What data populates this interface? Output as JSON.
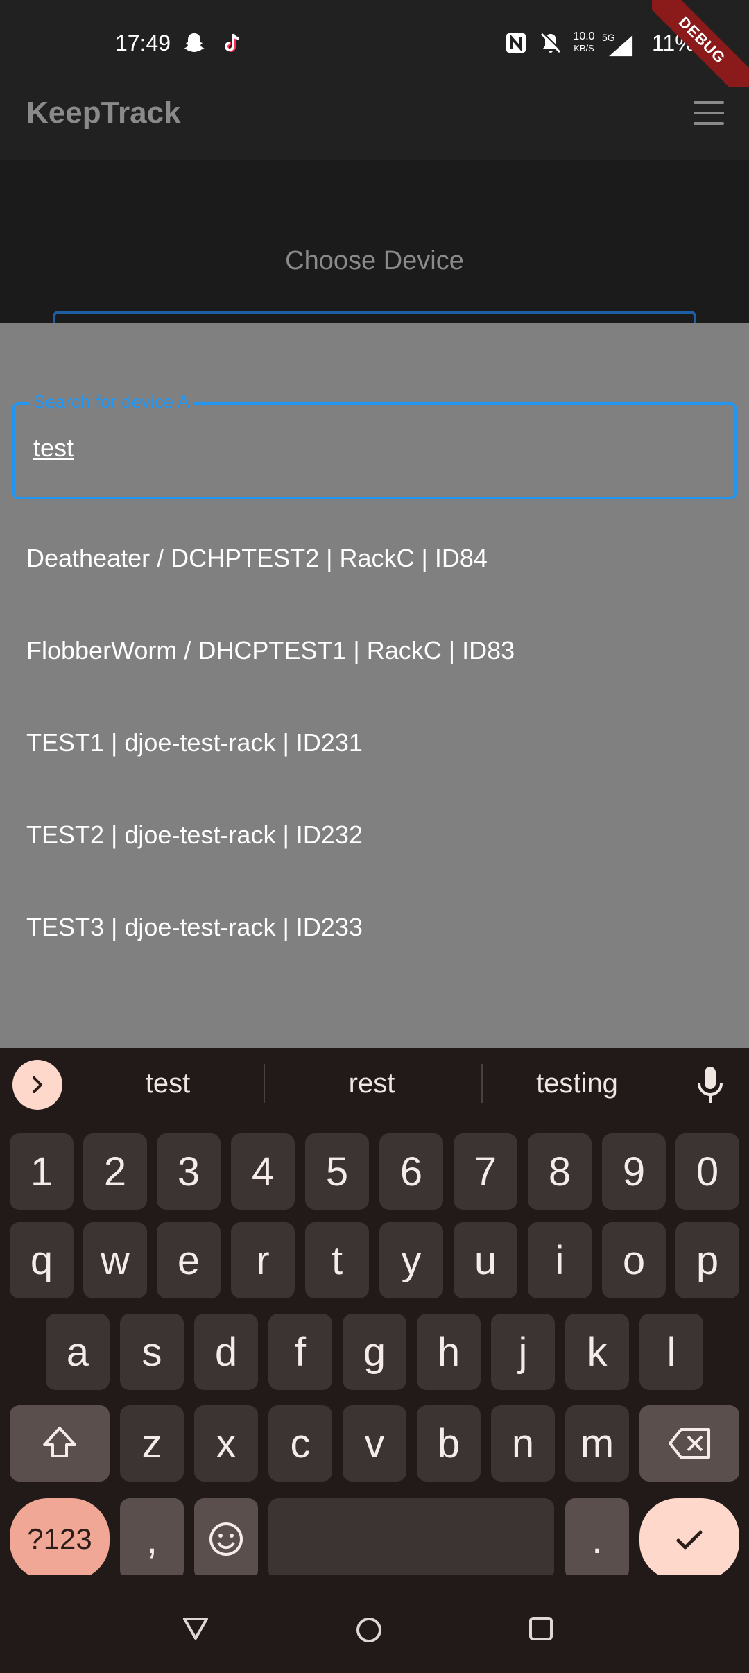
{
  "status_bar": {
    "time": "17:49",
    "net_speed_value": "10.0",
    "net_speed_unit": "KB/S",
    "network_type": "5G",
    "battery": "11%",
    "debug_banner": "DEBUG",
    "icons": [
      "snapchat-icon",
      "tiktok-icon",
      "nfc-icon",
      "mute-icon",
      "signal-icon"
    ]
  },
  "app_bar": {
    "title": "KeepTrack",
    "menu_icon": "hamburger-menu-icon"
  },
  "page": {
    "heading": "Choose Device"
  },
  "search": {
    "label": "Search for device A",
    "value": "test"
  },
  "results": [
    "Deatheater / DCHPTEST2 | RackC | ID84",
    "FlobberWorm / DHCPTEST1 | RackC | ID83",
    "TEST1 | djoe-test-rack | ID231",
    "TEST2 | djoe-test-rack | ID232",
    "TEST3 | djoe-test-rack | ID233"
  ],
  "keyboard": {
    "suggestions": [
      "test",
      "rest",
      "testing"
    ],
    "row_numbers": [
      "1",
      "2",
      "3",
      "4",
      "5",
      "6",
      "7",
      "8",
      "9",
      "0"
    ],
    "row1": [
      "q",
      "w",
      "e",
      "r",
      "t",
      "y",
      "u",
      "i",
      "o",
      "p"
    ],
    "row2": [
      "a",
      "s",
      "d",
      "f",
      "g",
      "h",
      "j",
      "k",
      "l"
    ],
    "row3": [
      "z",
      "x",
      "c",
      "v",
      "b",
      "n",
      "m"
    ],
    "symbols_key": "?123",
    "comma_key": ",",
    "period_key": "."
  },
  "colors": {
    "accent_blue": "#2196f3",
    "sheet_grey": "#808080",
    "keyboard_bg": "#211a18",
    "key_accent": "#ffd8cc",
    "debug_red": "#8b1a1a"
  }
}
